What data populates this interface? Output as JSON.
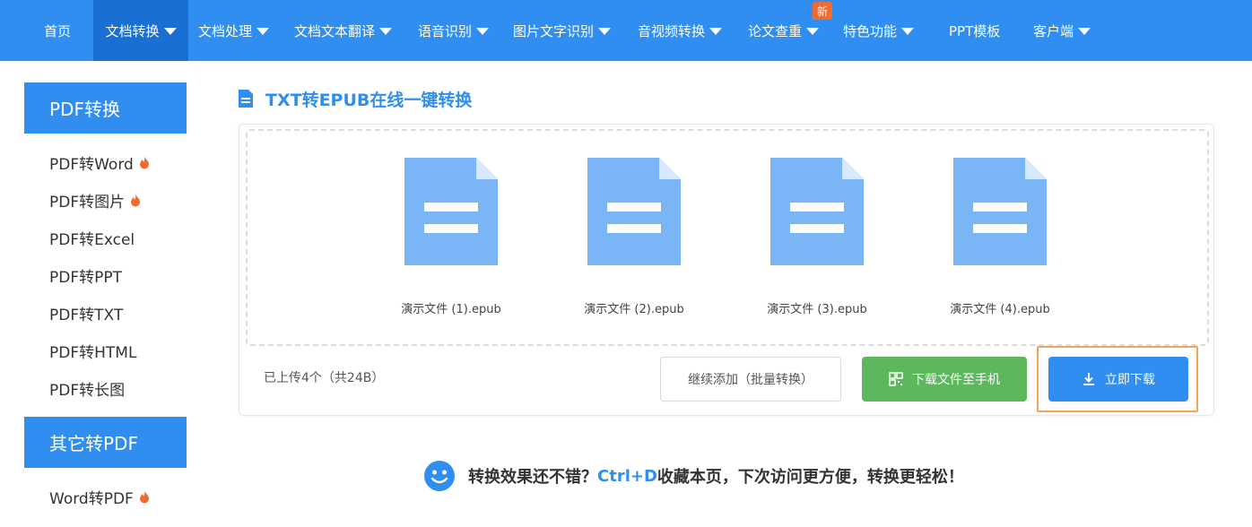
{
  "nav": {
    "items": [
      {
        "label": "首页",
        "caret": false
      },
      {
        "label": "文档转换",
        "caret": true,
        "active": true
      },
      {
        "label": "文档处理",
        "caret": true
      },
      {
        "label": "文档文本翻译",
        "caret": true
      },
      {
        "label": "语音识别",
        "caret": true
      },
      {
        "label": "图片文字识别",
        "caret": true
      },
      {
        "label": "音视频转换",
        "caret": true
      },
      {
        "label": "论文查重",
        "caret": true
      },
      {
        "label": "特色功能",
        "caret": true
      },
      {
        "label": "PPT模板",
        "caret": false
      },
      {
        "label": "客户端",
        "caret": true
      }
    ],
    "new_badge": "新"
  },
  "sidebar": {
    "section1_title": "PDF转换",
    "section1_items": [
      {
        "label": "PDF转Word",
        "hot": true
      },
      {
        "label": "PDF转图片",
        "hot": true
      },
      {
        "label": "PDF转Excel",
        "hot": false
      },
      {
        "label": "PDF转PPT",
        "hot": false
      },
      {
        "label": "PDF转TXT",
        "hot": false
      },
      {
        "label": "PDF转HTML",
        "hot": false
      },
      {
        "label": "PDF转长图",
        "hot": false
      }
    ],
    "section2_title": "其它转PDF",
    "section2_items": [
      {
        "label": "Word转PDF",
        "hot": true
      }
    ]
  },
  "main": {
    "heading": "TXT转EPUB在线一键转换",
    "files": [
      {
        "name": "演示文件 (1).epub"
      },
      {
        "name": "演示文件 (2).epub"
      },
      {
        "name": "演示文件 (3).epub"
      },
      {
        "name": "演示文件 (4).epub"
      }
    ],
    "status": "已上传4个（共24B）",
    "btn_continue": "继续添加（批量转换）",
    "btn_phone": "下载文件至手机",
    "btn_download": "立即下载",
    "tip_pre": "转换效果还不错？",
    "tip_hotkey": "Ctrl+D",
    "tip_post": "收藏本页，下次访问更方便，转换更轻松！"
  },
  "colors": {
    "brand_blue": "#2f8ef0",
    "nav_active": "#1a6fd2",
    "green": "#5cb85c",
    "file_icon": "#7ab6f5",
    "highlight": "#f0a559",
    "badge": "#f26a2f"
  },
  "icons": {
    "heading_icon": "document-icon",
    "file_icon": "file-icon",
    "hot_icon": "fire-icon",
    "qr_icon": "qrcode-icon",
    "download_icon": "download-icon",
    "smile_icon": "smile-icon"
  }
}
